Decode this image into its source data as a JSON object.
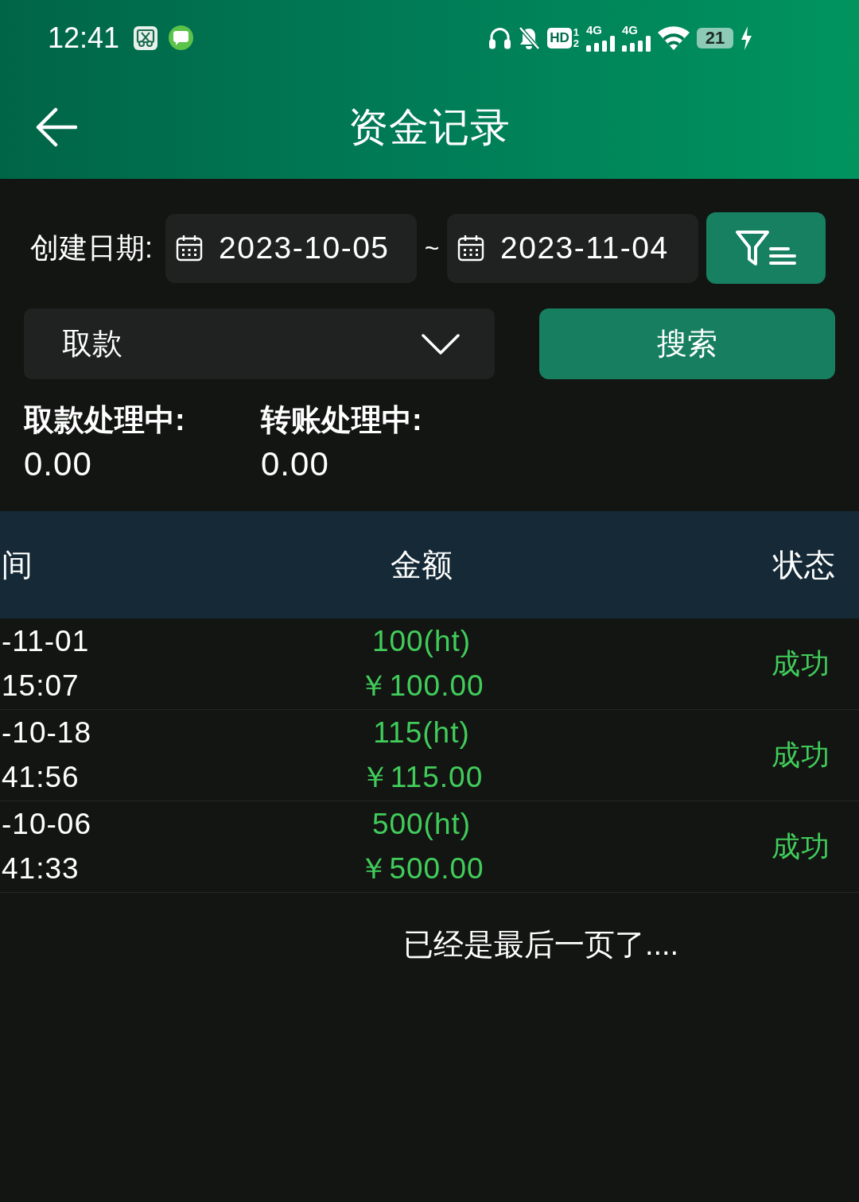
{
  "status_bar": {
    "time": "12:41",
    "hd_badge": "HD",
    "sim_slots": [
      "1",
      "2"
    ],
    "networks": [
      "4G",
      "4G"
    ],
    "battery": "21",
    "charging": true
  },
  "header": {
    "title": "资金记录"
  },
  "filters": {
    "date_label": "创建日期:",
    "start_date": "2023-10-05",
    "separator": "~",
    "end_date": "2023-11-04",
    "type_select": "取款",
    "search_button": "搜索"
  },
  "summary": [
    {
      "label": "取款处理中:",
      "value": "0.00"
    },
    {
      "label": "转账处理中:",
      "value": "0.00"
    }
  ],
  "table": {
    "columns": [
      "间",
      "金额",
      "状态"
    ],
    "rows": [
      {
        "date": "-11-01",
        "time": "15:07",
        "amount": "100(ht)",
        "price": "￥100.00",
        "status": "成功"
      },
      {
        "date": "-10-18",
        "time": "41:56",
        "amount": "115(ht)",
        "price": "￥115.00",
        "status": "成功"
      },
      {
        "date": "-10-06",
        "time": "41:33",
        "amount": "500(ht)",
        "price": "￥500.00",
        "status": "成功"
      }
    ]
  },
  "footer": "已经是最后一页了...."
}
